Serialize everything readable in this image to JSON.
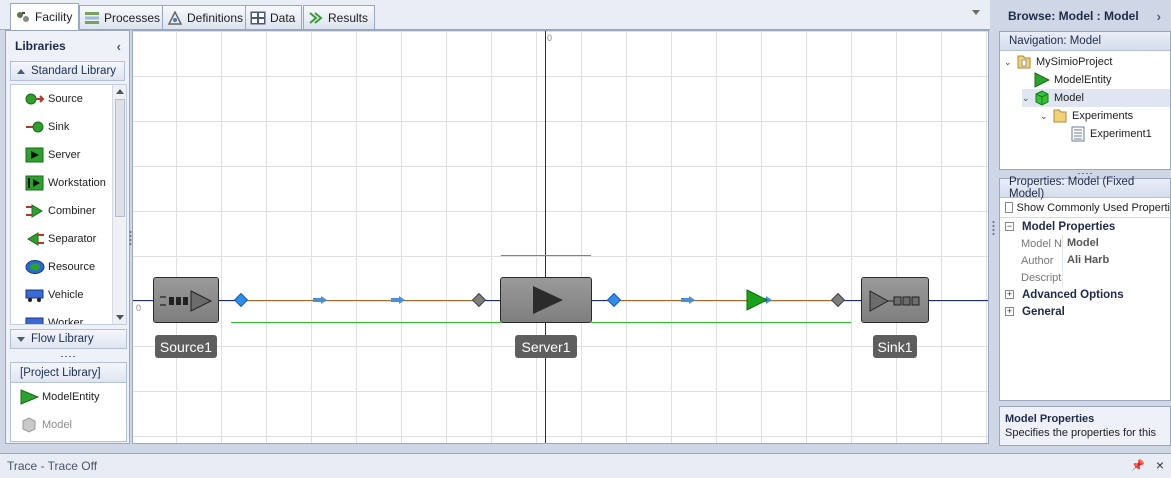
{
  "tabs": [
    {
      "label": "Facility",
      "icon": "facility-icon",
      "active": true
    },
    {
      "label": "Processes",
      "icon": "processes-icon",
      "active": false
    },
    {
      "label": "Definitions",
      "icon": "definitions-icon",
      "active": false
    },
    {
      "label": "Data",
      "icon": "data-icon",
      "active": false
    },
    {
      "label": "Results",
      "icon": "results-icon",
      "active": false
    }
  ],
  "libraries": {
    "title": "Libraries",
    "standard_group": "Standard Library",
    "standard_items": [
      {
        "label": "Source",
        "icon": "source-icon"
      },
      {
        "label": "Sink",
        "icon": "sink-icon"
      },
      {
        "label": "Server",
        "icon": "server-icon"
      },
      {
        "label": "Workstation",
        "icon": "workstation-icon"
      },
      {
        "label": "Combiner",
        "icon": "combiner-icon"
      },
      {
        "label": "Separator",
        "icon": "separator-icon"
      },
      {
        "label": "Resource",
        "icon": "resource-icon"
      },
      {
        "label": "Vehicle",
        "icon": "vehicle-icon"
      },
      {
        "label": "Worker",
        "icon": "worker-icon"
      }
    ],
    "flow_group": "Flow Library",
    "project_group": "[Project Library]",
    "project_items": [
      {
        "label": "ModelEntity",
        "icon": "model-entity-icon"
      },
      {
        "label": "Model",
        "icon": "model-icon"
      }
    ]
  },
  "canvas": {
    "origin_x_label": "0",
    "origin_y_label": "0",
    "objects": [
      {
        "name": "Source1",
        "type": "source"
      },
      {
        "name": "Server1",
        "type": "server"
      },
      {
        "name": "Sink1",
        "type": "sink"
      }
    ]
  },
  "right": {
    "browse_title": "Browse: Model : Model",
    "navigation": {
      "title": "Navigation: Model",
      "tree": [
        {
          "label": "MySimioProject",
          "level": 0,
          "expander": "v",
          "icon": "project-folder-icon"
        },
        {
          "label": "ModelEntity",
          "level": 1,
          "expander": "",
          "icon": "model-entity-icon"
        },
        {
          "label": "Model",
          "level": 1,
          "expander": "v",
          "icon": "model-cube-icon",
          "selected": true
        },
        {
          "label": "Experiments",
          "level": 2,
          "expander": "v",
          "icon": "experiments-folder-icon"
        },
        {
          "label": "Experiment1",
          "level": 3,
          "expander": "",
          "icon": "experiment-icon"
        }
      ]
    },
    "properties": {
      "title": "Properties: Model (Fixed Model)",
      "show_common": "Show Commonly Used Properti",
      "category_model": "Model Properties",
      "rows": [
        {
          "key": "Model N...",
          "value": "Model"
        },
        {
          "key": "Author",
          "value": "Ali Harb"
        },
        {
          "key": "Descript...",
          "value": ""
        }
      ],
      "category_advanced": "Advanced Options",
      "category_general": "General"
    },
    "description": {
      "title": "Model Properties",
      "text": "Specifies the properties for this"
    }
  },
  "trace": {
    "label": "Trace - Trace Off"
  },
  "colors": {
    "node_out": "#2f8df0",
    "node_in": "#7e7e7e",
    "path": "#a06a28",
    "axis": "#1c2a7a",
    "green_entity": "#1aa31a"
  }
}
